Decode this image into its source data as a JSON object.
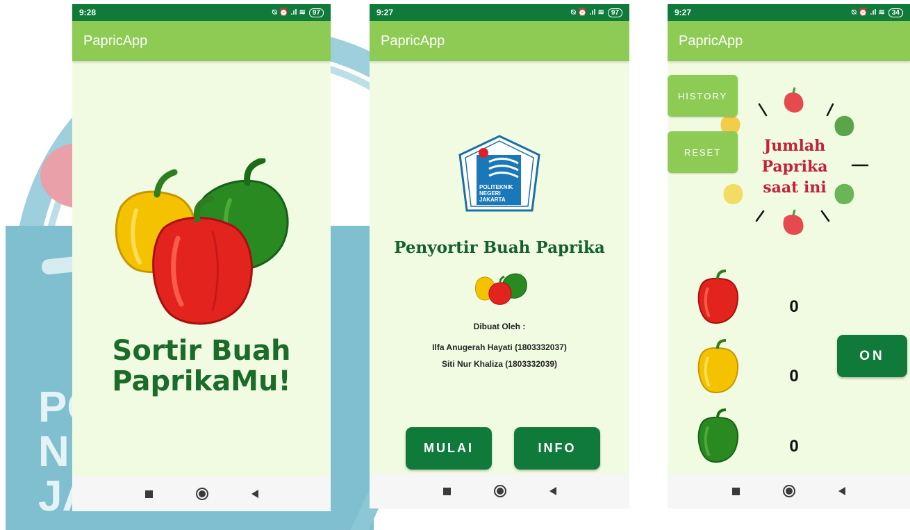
{
  "screen1": {
    "status": {
      "time": "9:28",
      "icons": "⍉ ⏰ .ıl ≋",
      "battery": "97"
    },
    "app_title": "PapricApp",
    "tagline_line1": "Sortir Buah",
    "tagline_line2": "PaprikaMu!"
  },
  "screen2": {
    "status": {
      "time": "9:27",
      "icons": "⍉ ⏰ .ıl ≋",
      "battery": "97"
    },
    "app_title": "PapricApp",
    "logo_text": [
      "POLITEKNIK",
      "NEGERI",
      "JAKARTA"
    ],
    "title": "Penyortir Buah Paprika",
    "credits_header": "Dibuat Oleh :",
    "credits": [
      "Ilfa Anugerah Hayati (1803332037)",
      "Siti Nur Khaliza (1803332039)"
    ],
    "button_mulai": "MULAI",
    "button_info": "INFO"
  },
  "screen3": {
    "status": {
      "time": "9:27",
      "icons": "⍉ ⏰ .ıl ≋",
      "battery": "34"
    },
    "app_title": "PapricApp",
    "button_history": "HISTORY",
    "button_reset": "RESET",
    "count_title": [
      "Jumlah",
      "Paprika",
      "saat ini"
    ],
    "counts": {
      "red": "0",
      "yellow": "0",
      "green": "0"
    },
    "button_on": "ON"
  },
  "colors": {
    "statusbar": "#0f7a3a",
    "appbar": "#8dcb55",
    "background": "#f1fbe1",
    "accent": "#0f7a3a",
    "count_title": "#c4223a"
  },
  "watermark_text": [
    "PO",
    "NE",
    "JA"
  ]
}
